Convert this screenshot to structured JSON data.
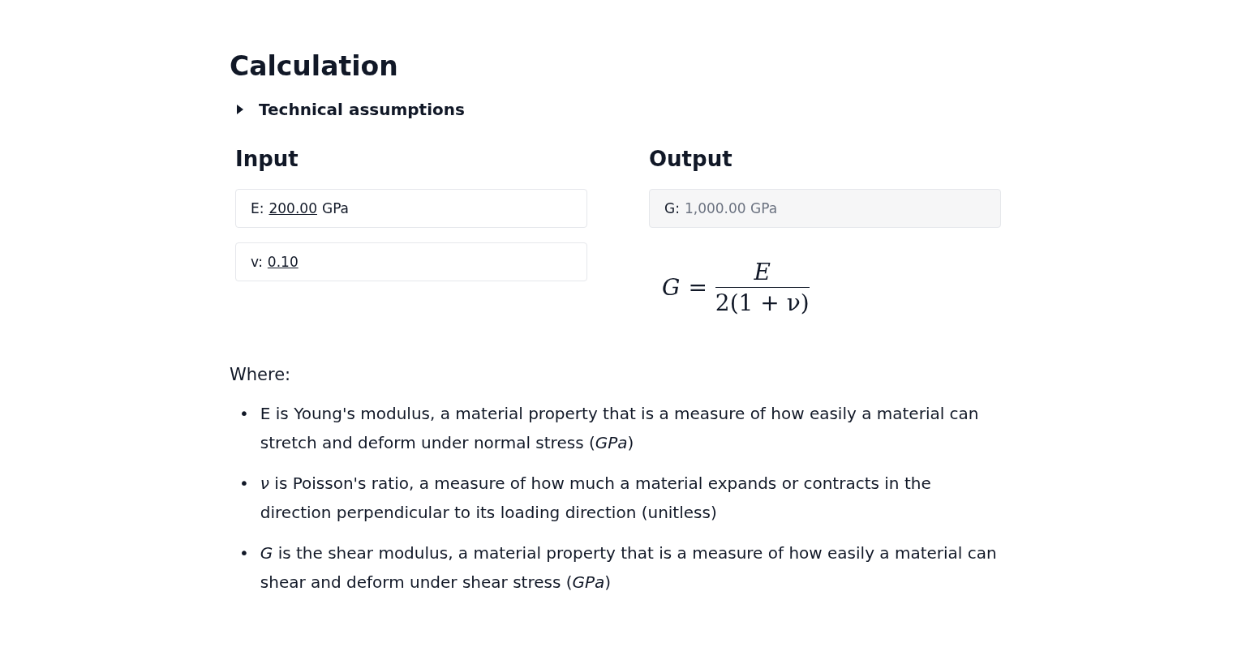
{
  "title": "Calculation",
  "assumptions": {
    "label": "Technical assumptions",
    "expanded": false
  },
  "input": {
    "heading": "Input",
    "fields": [
      {
        "label": "E:",
        "value": "200.00",
        "unit": "GPa"
      },
      {
        "label": "v:",
        "value": "0.10"
      }
    ]
  },
  "output": {
    "heading": "Output",
    "field": {
      "label": "G:",
      "value": "1,000.00 GPa",
      "disabled": true
    },
    "formula": {
      "lhs": "G",
      "equals": "=",
      "numerator": "E",
      "denominator": "2(1 + ν)"
    }
  },
  "where": "Where:",
  "definitions": [
    {
      "bullet": "•",
      "text": "E is Young's modulus, a material property that is a measure of how easily a material can stretch and deform under normal stress (*GPa*)"
    },
    {
      "bullet": "•",
      "text": "*ν* is Poisson's ratio, a measure of how much a material expands or contracts in the direction perpendicular to its loading direction (unitless)"
    },
    {
      "bullet": "•",
      "text": "*G* is the shear modulus, a material property that is a measure of how easily a material can shear and deform under shear stress (*GPa*)"
    }
  ]
}
